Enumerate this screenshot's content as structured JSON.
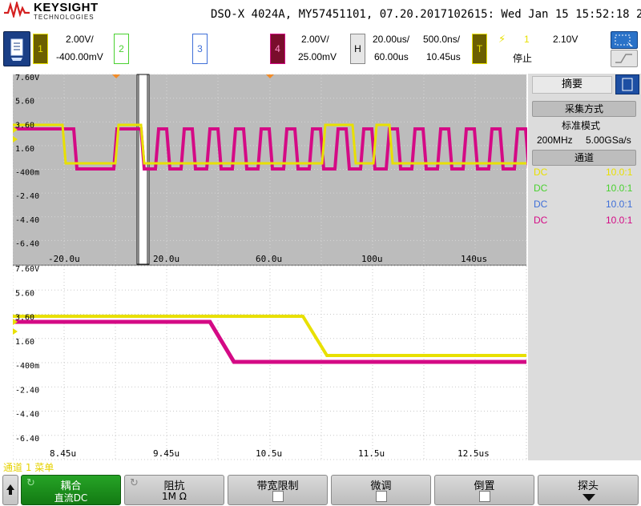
{
  "header": {
    "brand": "KEYSIGHT",
    "brand_sub": "TECHNOLOGIES",
    "model_line": "DSO-X 4024A, MY57451101, 07.20.2017102615: Wed Jan 15 15:52:18 2020"
  },
  "channels": [
    {
      "num": "1",
      "scale": "2.00V/",
      "offset": "-400.00mV",
      "color": "#e8e000"
    },
    {
      "num": "2",
      "color": "#49d12f"
    },
    {
      "num": "3",
      "color": "#3f6fd8"
    },
    {
      "num": "4",
      "scale": "2.00V/",
      "offset": "25.00mV",
      "color": "#d40a85"
    }
  ],
  "horizontal": {
    "label": "H",
    "scale": "20.00us/",
    "delay": "60.00us",
    "zoom_scale": "500.0ns/",
    "zoom_delay": "10.45us"
  },
  "trigger": {
    "label": "T",
    "source": "1",
    "level": "2.10V",
    "status": "停止"
  },
  "main_window": {
    "y_labels": [
      "7.60V",
      "5.60",
      "3.60",
      "1.60",
      "-400m",
      "-2.40",
      "-4.40",
      "-6.40"
    ],
    "x_labels": [
      "-20.0u",
      "20.0u",
      "60.0u",
      "100u",
      "140us"
    ]
  },
  "zoom_window": {
    "y_labels": [
      "7.60V",
      "5.60",
      "3.60",
      "1.60",
      "-400m",
      "-2.40",
      "-4.40",
      "-6.40"
    ],
    "x_labels": [
      "8.45u",
      "9.45u",
      "10.5u",
      "11.5u",
      "12.5us"
    ]
  },
  "side_panel": {
    "title": "摘要",
    "acq_header": "采集方式",
    "acq_mode": "标准模式",
    "acq_rate_bw": "200MHz",
    "acq_rate_sa": "5.00GSa/s",
    "channels_header": "通道",
    "probe_rows": [
      {
        "coupling": "DC",
        "ratio": "10.0:1",
        "color": "#e8e000"
      },
      {
        "coupling": "DC",
        "ratio": "10.0:1",
        "color": "#49d12f"
      },
      {
        "coupling": "DC",
        "ratio": "10.0:1",
        "color": "#3f6fd8"
      },
      {
        "coupling": "DC",
        "ratio": "10.0:1",
        "color": "#d40a85"
      }
    ]
  },
  "status_bar": {
    "text": "通道 1 菜单"
  },
  "softkeys": {
    "coupling": {
      "label": "耦合",
      "value": "直流DC"
    },
    "impedance": {
      "label": "阻抗",
      "value": "1M Ω"
    },
    "bw_limit": {
      "label": "带宽限制"
    },
    "fine": {
      "label": "微调"
    },
    "invert": {
      "label": "倒置"
    },
    "probe": {
      "label": "探头"
    }
  },
  "colors": {
    "ch1": "#e8e000",
    "ch4": "#d40a85",
    "grid_bg_main": "#bcbcbc",
    "grid_bg_zoom": "#ffffff",
    "softkey_active": "#1a8a1a"
  }
}
